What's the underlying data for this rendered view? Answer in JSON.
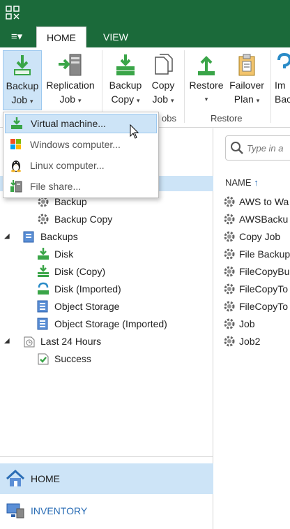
{
  "menu": {
    "main_menu_glyph": "≡▾",
    "tabs": [
      {
        "label": "HOME",
        "active": true
      },
      {
        "label": "VIEW",
        "active": false
      }
    ]
  },
  "ribbon": {
    "buttons": [
      {
        "line1": "Backup",
        "line2": "Job",
        "caret": "▾",
        "icon": "backup-job-icon"
      },
      {
        "line1": "Replication",
        "line2": "Job",
        "caret": "▾",
        "icon": "replication-job-icon"
      },
      {
        "line1": "Backup",
        "line2": "Copy",
        "caret": "▾",
        "icon": "backup-copy-icon"
      },
      {
        "line1": "Copy",
        "line2": "Job",
        "caret": "▾",
        "icon": "copy-job-icon"
      },
      {
        "line1": "Restore",
        "line2": "",
        "caret": "▾",
        "icon": "restore-icon"
      },
      {
        "line1": "Failover",
        "line2": "Plan",
        "caret": "▾",
        "icon": "failover-plan-icon"
      },
      {
        "line1": "Im",
        "line2": "Bac",
        "caret": "",
        "icon": "import-backup-icon"
      }
    ],
    "groups": [
      {
        "label": "obs"
      },
      {
        "label": "Restore"
      }
    ]
  },
  "dropdown": {
    "items": [
      {
        "label": "Virtual machine...",
        "icon": "virtual-machine-icon",
        "hover": true
      },
      {
        "label": "Windows computer...",
        "icon": "windows-computer-icon",
        "hover": false
      },
      {
        "label": "Linux computer...",
        "icon": "linux-computer-icon",
        "hover": false
      },
      {
        "label": "File share...",
        "icon": "file-share-icon",
        "hover": false
      }
    ]
  },
  "tree": {
    "items": [
      {
        "label": "Backup",
        "icon": "backup-job-node-icon"
      },
      {
        "label": "Backup Copy",
        "icon": "backup-copy-node-icon"
      },
      {
        "label": "Backups",
        "icon": "backups-icon",
        "expander": "◢"
      },
      {
        "label": "Disk",
        "icon": "disk-icon"
      },
      {
        "label": "Disk (Copy)",
        "icon": "disk-copy-icon"
      },
      {
        "label": "Disk (Imported)",
        "icon": "disk-imported-icon"
      },
      {
        "label": "Object Storage",
        "icon": "object-storage-icon"
      },
      {
        "label": "Object Storage (Imported)",
        "icon": "object-storage-imported-icon"
      },
      {
        "label": "Last 24 Hours",
        "icon": "last-24-hours-icon",
        "expander": "◢"
      },
      {
        "label": "Success",
        "icon": "success-icon"
      }
    ]
  },
  "nav": {
    "home": "HOME",
    "inventory": "INVENTORY"
  },
  "right": {
    "search_placeholder": "Type in a",
    "column_header": "NAME",
    "sort_arrow": "↑",
    "jobs": [
      "AWS to Wa",
      "AWSBacku",
      "Copy Job",
      "File Backup",
      "FileCopyBu",
      "FileCopyTo",
      "FileCopyTo",
      "Job",
      "Job2"
    ]
  },
  "colors": {
    "titlebar": "#1b6a3a",
    "selection": "#cde4f7",
    "accent_blue": "#2a6db5",
    "veeam_green": "#3aa548"
  }
}
